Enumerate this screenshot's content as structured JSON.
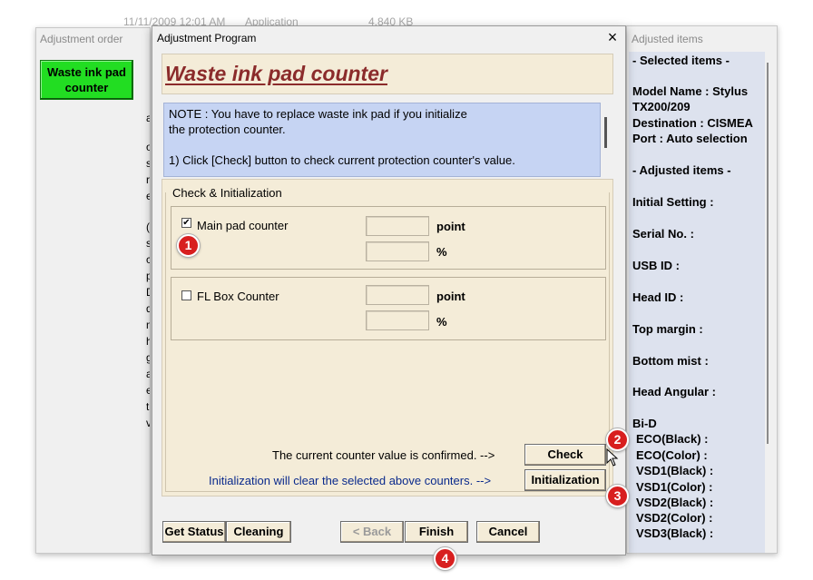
{
  "background": {
    "date": "11/11/2009 12:01 AM",
    "type": "Application",
    "size": "4,840 KB"
  },
  "left_window": {
    "title": "Adjustment order",
    "button_label": "Waste ink pad counter",
    "peek_chars": [
      "a",
      "o",
      "s",
      "r",
      "e",
      "(",
      "s",
      "c",
      "p",
      "D",
      "d",
      "m",
      "h",
      "g",
      "a",
      "e",
      "t",
      "v"
    ]
  },
  "dialog": {
    "title": "Adjustment Program",
    "close_glyph": "×",
    "banner_title": "Waste ink pad counter",
    "note_lines": [
      "NOTE : You have to replace waste ink pad if you initialize",
      "the protection counter.",
      "",
      "1) Click [Check] button to check current protection counter's value."
    ],
    "group_title": "Check & Initialization",
    "main_pad": {
      "label": "Main pad counter",
      "checked": true,
      "unit1": "point",
      "unit2": "%"
    },
    "fl_box": {
      "label": "FL Box Counter",
      "checked": false,
      "unit1": "point",
      "unit2": "%"
    },
    "confirm_text": "The current counter value is confirmed. -->",
    "init_text": "Initialization will clear the selected above counters. -->",
    "check_button": "Check",
    "init_button": "Initialization",
    "get_status_button": "Get Status",
    "cleaning_button": "Cleaning",
    "back_button": "< Back",
    "finish_button": "Finish",
    "cancel_button": "Cancel"
  },
  "right_window": {
    "title": "Adjusted items",
    "items": [
      "- Selected items -",
      "Model Name : Stylus",
      "TX200/209",
      "Destination : CISMEA",
      "Port : Auto selection",
      "- Adjusted items -",
      "Initial Setting :",
      "Serial No. :",
      "USB ID :",
      "Head ID :",
      "Top margin :",
      "Bottom mist :",
      "Head Angular :",
      "Bi-D",
      " ECO(Black)  :",
      " ECO(Color)  :",
      " VSD1(Black) :",
      " VSD1(Color) :",
      " VSD2(Black) :",
      " VSD2(Color) :",
      " VSD3(Black) :"
    ]
  },
  "badges": [
    "1",
    "2",
    "3",
    "4"
  ],
  "colors": {
    "green_button": "#22dd22",
    "banner_title": "#8b2b2b",
    "note_bg": "#c6d4f3",
    "badge": "#d81f1f"
  }
}
